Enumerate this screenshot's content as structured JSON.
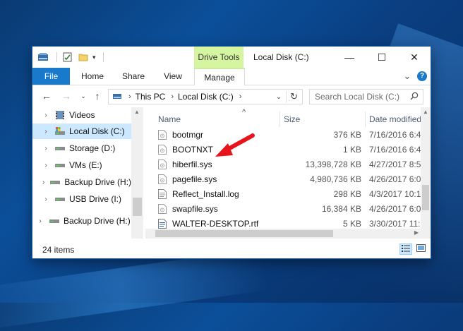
{
  "window": {
    "title": "Local Disk (C:)",
    "context_tab": "Drive Tools",
    "minimize_glyph": "—",
    "maximize_glyph": "☐",
    "close_glyph": "✕"
  },
  "ribbon": {
    "tabs": [
      "File",
      "Home",
      "Share",
      "View",
      "Manage"
    ],
    "expand_glyph": "⌄",
    "help_glyph": "?"
  },
  "address": {
    "breadcrumbs": [
      "This PC",
      "Local Disk (C:)"
    ],
    "search_placeholder": "Search Local Disk (C:)"
  },
  "navigation_pane": {
    "items": [
      {
        "label": "Videos",
        "icon": "video-folder-icon",
        "selected": false
      },
      {
        "label": "Local Disk (C:)",
        "icon": "system-drive-icon",
        "selected": true
      },
      {
        "label": "Storage (D:)",
        "icon": "drive-icon",
        "selected": false
      },
      {
        "label": "VMs (E:)",
        "icon": "drive-icon",
        "selected": false
      },
      {
        "label": "Backup Drive (H:)",
        "icon": "drive-icon",
        "selected": false
      },
      {
        "label": "USB Drive (I:)",
        "icon": "drive-icon",
        "selected": false
      },
      {
        "label": "Backup Drive (H:)",
        "icon": "drive-icon",
        "selected": false
      }
    ]
  },
  "file_list": {
    "columns": [
      "Name",
      "Size",
      "Date modified"
    ],
    "rows": [
      {
        "name": "bootmgr",
        "size": "376 KB",
        "date": "7/16/2016 6:4",
        "icon": "system-file-icon"
      },
      {
        "name": "BOOTNXT",
        "size": "1 KB",
        "date": "7/16/2016 6:4",
        "icon": "system-file-icon"
      },
      {
        "name": "hiberfil.sys",
        "size": "13,398,728 KB",
        "date": "4/27/2017 8:5",
        "icon": "system-file-icon"
      },
      {
        "name": "pagefile.sys",
        "size": "4,980,736 KB",
        "date": "4/26/2017 6:0",
        "icon": "system-file-icon"
      },
      {
        "name": "Reflect_Install.log",
        "size": "298 KB",
        "date": "4/3/2017 10:1",
        "icon": "text-file-icon"
      },
      {
        "name": "swapfile.sys",
        "size": "16,384 KB",
        "date": "4/26/2017 6:0",
        "icon": "system-file-icon"
      },
      {
        "name": "WALTER-DESKTOP.rtf",
        "size": "5 KB",
        "date": "3/30/2017 11:",
        "icon": "document-file-icon"
      }
    ]
  },
  "status_bar": {
    "item_count": "24 items"
  },
  "colors": {
    "accent": "#1979ca",
    "selection": "#cce8ff",
    "context_tab": "#d6f5a0",
    "annotation_arrow": "#e8141c"
  }
}
